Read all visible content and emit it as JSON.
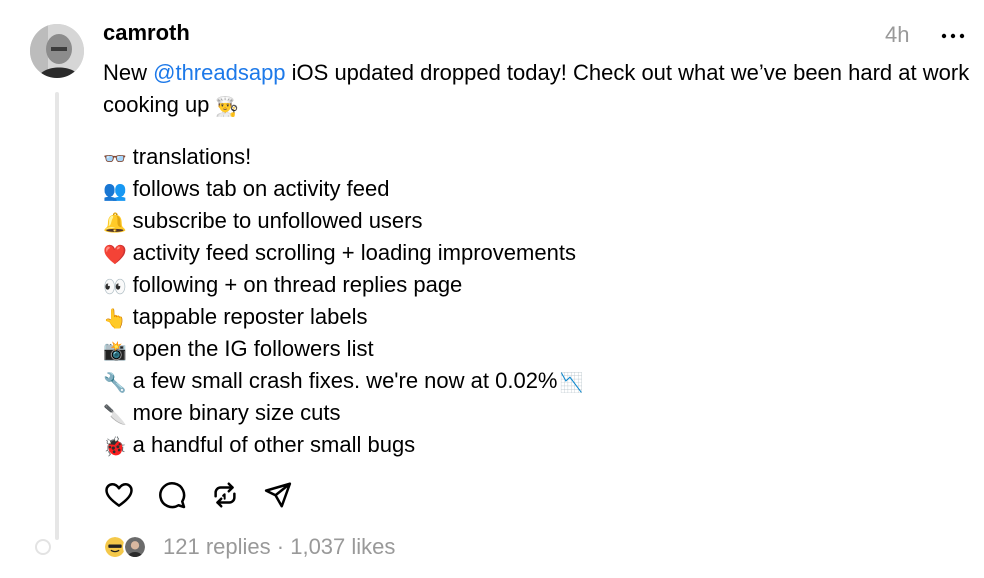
{
  "post": {
    "author": "camroth",
    "timestamp": "4h",
    "intro": {
      "before_mention": "New ",
      "mention": "@threadsapp",
      "after_mention": " iOS updated dropped today! Check out what we’ve been hard at work cooking up",
      "emoji": "👨‍🍳"
    },
    "items": [
      {
        "emoji": "👓",
        "text": "translations!"
      },
      {
        "emoji": "👥",
        "text": "follows tab on activity feed"
      },
      {
        "emoji": "🔔",
        "text": "subscribe to unfollowed users"
      },
      {
        "emoji": "❤️",
        "text": "activity feed scrolling + loading improvements"
      },
      {
        "emoji": "👀",
        "text": "following + on thread replies page"
      },
      {
        "emoji": "👆",
        "text": "tappable reposter labels"
      },
      {
        "emoji": "📸",
        "text": "open the IG followers list"
      },
      {
        "emoji": "🔧",
        "text": "a few small crash fixes. we're now at 0.02%",
        "trailing_emoji": "📉"
      },
      {
        "emoji": "🔪",
        "text": "more binary size cuts"
      },
      {
        "emoji": "🐞",
        "text": "a handful of other small bugs"
      }
    ]
  },
  "actions": {
    "icons": [
      "heart-icon",
      "comment-icon",
      "repost-icon",
      "share-icon"
    ]
  },
  "footer": {
    "replies": "121 replies",
    "separator": "·",
    "likes": "1,037 likes"
  },
  "colors": {
    "mention": "#1d79e9",
    "muted": "#999999",
    "thread_line": "#e6e6e6"
  }
}
